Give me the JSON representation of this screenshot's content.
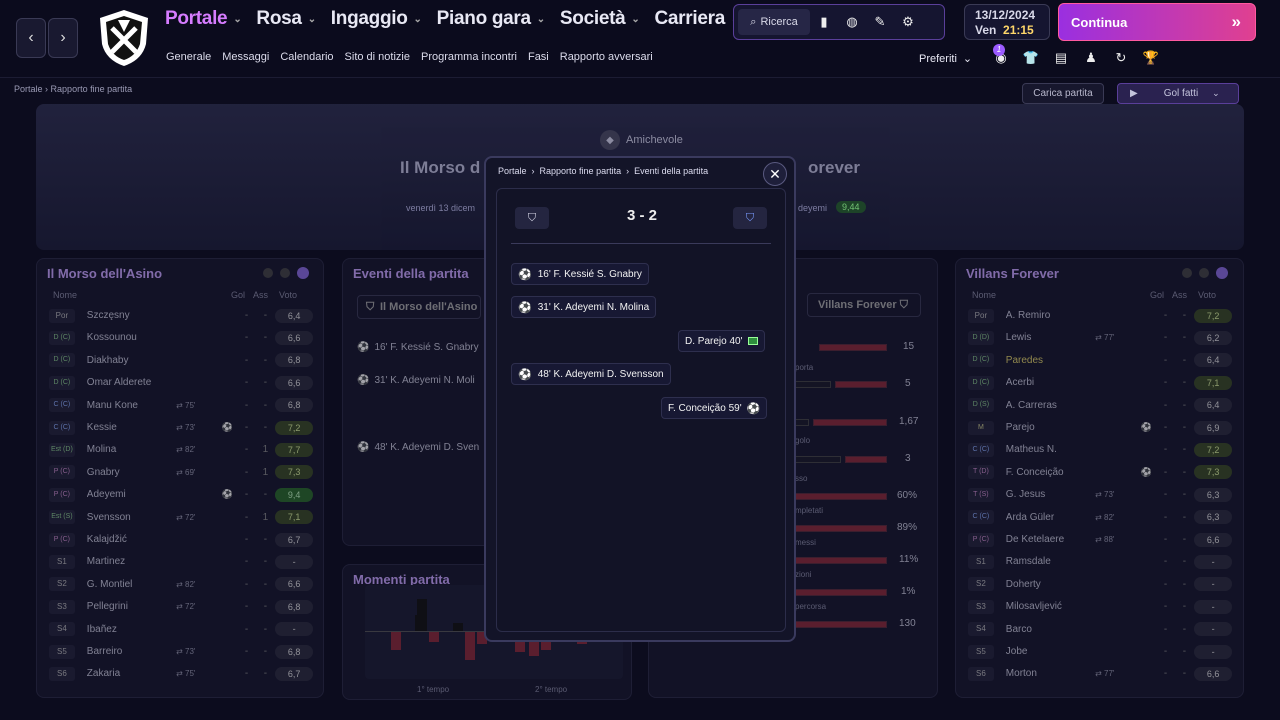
{
  "nav": {
    "items": [
      {
        "label": "Portale",
        "active": true
      },
      {
        "label": "Rosa"
      },
      {
        "label": "Ingaggio"
      },
      {
        "label": "Piano gara"
      },
      {
        "label": "Società"
      },
      {
        "label": "Carriera"
      }
    ],
    "sub": [
      "Generale",
      "Messaggi",
      "Calendario",
      "Sito di notizie",
      "Programma incontri",
      "Fasi",
      "Rapporto avversari"
    ],
    "search_label": "Ricerca",
    "date": "13/12/2024",
    "day": "Ven",
    "time": "21:15",
    "continue_label": "Continua",
    "prefs_label": "Preferiti",
    "notif_count": "1"
  },
  "breadcrumb": [
    "Portale",
    "Rapporto fine partita"
  ],
  "actions": {
    "load": "Carica partita",
    "goals": "Gol fatti"
  },
  "hero": {
    "competition": "Amichevole",
    "home": "Il Morso d",
    "away": "orever",
    "date": "venerdì 13 dicem",
    "motm": "deyemi",
    "motm_rating": "9,44"
  },
  "modal": {
    "breadcrumb": [
      "Portale",
      "Rapporto fine partita",
      "Eventi della partita"
    ],
    "score": "3 - 2",
    "events": [
      {
        "side": "home",
        "minute": "16'",
        "scorer": "F. Kessié",
        "assist": "S. Gnabry"
      },
      {
        "side": "home",
        "minute": "31'",
        "scorer": "K. Adeyemi",
        "assist": "N. Molina"
      },
      {
        "side": "away",
        "text": "D. Parejo 40'",
        "type": "card"
      },
      {
        "side": "home",
        "minute": "48'",
        "scorer": "K. Adeyemi",
        "assist": "D. Svensson"
      },
      {
        "side": "away",
        "text": "F. Conceição 59'",
        "type": "goal"
      }
    ]
  },
  "home_panel": {
    "title": "Il Morso dell'Asino",
    "headers": [
      "Nome",
      "Gol",
      "Ass",
      "Voto"
    ],
    "players": [
      {
        "pos": "Por",
        "name": "Szczęsny",
        "sub": "",
        "icon": "",
        "gol": "-",
        "ass": "-",
        "rating": "6,4",
        "c": "s"
      },
      {
        "pos": "D (C)",
        "name": "Kossounou",
        "sub": "",
        "icon": "",
        "gol": "-",
        "ass": "-",
        "rating": "6,6",
        "c": "g"
      },
      {
        "pos": "D (C)",
        "name": "Diakhaby",
        "sub": "",
        "icon": "",
        "gol": "-",
        "ass": "-",
        "rating": "6,8",
        "c": "g"
      },
      {
        "pos": "D (C)",
        "name": "Omar Alderete",
        "sub": "",
        "icon": "",
        "gol": "-",
        "ass": "-",
        "rating": "6,6",
        "c": "g"
      },
      {
        "pos": "C (C)",
        "name": "Manu Kone",
        "sub": "75'",
        "icon": "",
        "gol": "-",
        "ass": "-",
        "rating": "6,8",
        "c": "b"
      },
      {
        "pos": "C (C)",
        "name": "Kessie",
        "sub": "73'",
        "icon": "⚽",
        "gol": "-",
        "ass": "-",
        "rating": "7,2",
        "c": "b",
        "r": "gr"
      },
      {
        "pos": "Est (D)",
        "name": "Molina",
        "sub": "82'",
        "icon": "",
        "gol": "-",
        "ass": "1",
        "rating": "7,7",
        "c": "g",
        "r": "gr"
      },
      {
        "pos": "P (C)",
        "name": "Gnabry",
        "sub": "69'",
        "icon": "",
        "gol": "-",
        "ass": "1",
        "rating": "7,3",
        "c": "p",
        "r": "gr"
      },
      {
        "pos": "P (C)",
        "name": "Adeyemi",
        "sub": "",
        "icon": "⚽",
        "gol": "-",
        "ass": "-",
        "rating": "9,4",
        "c": "p",
        "r": "gg"
      },
      {
        "pos": "Est (S)",
        "name": "Svensson",
        "sub": "72'",
        "icon": "",
        "gol": "-",
        "ass": "1",
        "rating": "7,1",
        "c": "g",
        "r": "gr"
      },
      {
        "pos": "P (C)",
        "name": "Kalajdžić",
        "sub": "",
        "icon": "",
        "gol": "-",
        "ass": "-",
        "rating": "6,7",
        "c": "p"
      },
      {
        "pos": "S1",
        "name": "Martinez",
        "sub": "",
        "icon": "",
        "gol": "-",
        "ass": "-",
        "rating": "-",
        "c": "s"
      },
      {
        "pos": "S2",
        "name": "G. Montiel",
        "sub": "82'",
        "icon": "",
        "gol": "-",
        "ass": "-",
        "rating": "6,6",
        "c": "s"
      },
      {
        "pos": "S3",
        "name": "Pellegrini",
        "sub": "72'",
        "icon": "",
        "gol": "-",
        "ass": "-",
        "rating": "6,8",
        "c": "s"
      },
      {
        "pos": "S4",
        "name": "Ibañez",
        "sub": "",
        "icon": "",
        "gol": "-",
        "ass": "-",
        "rating": "-",
        "c": "s"
      },
      {
        "pos": "S5",
        "name": "Barreiro",
        "sub": "73'",
        "icon": "",
        "gol": "-",
        "ass": "-",
        "rating": "6,8",
        "c": "s"
      },
      {
        "pos": "S6",
        "name": "Zakaria",
        "sub": "75'",
        "icon": "",
        "gol": "-",
        "ass": "-",
        "rating": "6,7",
        "c": "s"
      }
    ]
  },
  "away_panel": {
    "title": "Villans Forever",
    "headers": [
      "Nome",
      "Gol",
      "Ass",
      "Voto"
    ],
    "players": [
      {
        "pos": "Por",
        "name": "Á. Remiro",
        "sub": "",
        "icon": "",
        "gol": "-",
        "ass": "-",
        "rating": "7,2",
        "c": "s",
        "r": "gr"
      },
      {
        "pos": "D (D)",
        "name": "Lewis",
        "sub": "77'",
        "icon": "",
        "gol": "-",
        "ass": "-",
        "rating": "6,2",
        "c": "g"
      },
      {
        "pos": "D (C)",
        "name": "Paredes",
        "sub": "",
        "icon": "",
        "gol": "-",
        "ass": "-",
        "rating": "6,4",
        "c": "g",
        "hl": true
      },
      {
        "pos": "D (C)",
        "name": "Acerbi",
        "sub": "",
        "icon": "",
        "gol": "-",
        "ass": "-",
        "rating": "7,1",
        "c": "g",
        "r": "gr"
      },
      {
        "pos": "D (S)",
        "name": "A. Carreras",
        "sub": "",
        "icon": "",
        "gol": "-",
        "ass": "-",
        "rating": "6,4",
        "c": "g"
      },
      {
        "pos": "M",
        "name": "Parejo",
        "sub": "",
        "icon": "⚽",
        "gol": "-",
        "ass": "-",
        "rating": "6,9",
        "c": "y"
      },
      {
        "pos": "C (C)",
        "name": "Matheus N.",
        "sub": "",
        "icon": "",
        "gol": "-",
        "ass": "-",
        "rating": "7,2",
        "c": "b",
        "r": "gr"
      },
      {
        "pos": "T (D)",
        "name": "F. Conceição",
        "sub": "",
        "icon": "⚽",
        "gol": "-",
        "ass": "-",
        "rating": "7,3",
        "c": "p",
        "r": "gr"
      },
      {
        "pos": "T (S)",
        "name": "G. Jesus",
        "sub": "73'",
        "icon": "",
        "gol": "-",
        "ass": "-",
        "rating": "6,3",
        "c": "p"
      },
      {
        "pos": "C (C)",
        "name": "Arda Güler",
        "sub": "82'",
        "icon": "",
        "gol": "-",
        "ass": "-",
        "rating": "6,3",
        "c": "b"
      },
      {
        "pos": "P (C)",
        "name": "De Ketelaere",
        "sub": "88'",
        "icon": "",
        "gol": "-",
        "ass": "-",
        "rating": "6,6",
        "c": "p"
      },
      {
        "pos": "S1",
        "name": "Ramsdale",
        "sub": "",
        "icon": "",
        "gol": "-",
        "ass": "-",
        "rating": "-",
        "c": "s"
      },
      {
        "pos": "S2",
        "name": "Doherty",
        "sub": "",
        "icon": "",
        "gol": "-",
        "ass": "-",
        "rating": "-",
        "c": "s"
      },
      {
        "pos": "S3",
        "name": "Milosavljević",
        "sub": "",
        "icon": "",
        "gol": "-",
        "ass": "-",
        "rating": "-",
        "c": "s"
      },
      {
        "pos": "S4",
        "name": "Barco",
        "sub": "",
        "icon": "",
        "gol": "-",
        "ass": "-",
        "rating": "-",
        "c": "s"
      },
      {
        "pos": "S5",
        "name": "Jobe",
        "sub": "",
        "icon": "",
        "gol": "-",
        "ass": "-",
        "rating": "-",
        "c": "s"
      },
      {
        "pos": "S6",
        "name": "Morton",
        "sub": "77'",
        "icon": "",
        "gol": "-",
        "ass": "-",
        "rating": "6,6",
        "c": "s"
      }
    ]
  },
  "events_panel": {
    "title": "Eventi della partita",
    "team": "Il Morso dell'Asino",
    "rows": [
      "16' F. Kessié S. Gnabry",
      "31' K. Adeyemi N. Moli",
      "48' K. Adeyemi D. Sven"
    ]
  },
  "stats_panel": {
    "team": "Villans Forever",
    "values": [
      "15",
      "5",
      "1,67",
      "3",
      "60%",
      "89%",
      "11%",
      "1%",
      "130"
    ],
    "labels": [
      "porta",
      "golo",
      "sso",
      "mpletati",
      "messi",
      "zioni",
      "percorsa"
    ]
  },
  "moments_panel": {
    "title": "Momenti partita",
    "labels": [
      "1° tempo",
      "2° tempo"
    ]
  }
}
